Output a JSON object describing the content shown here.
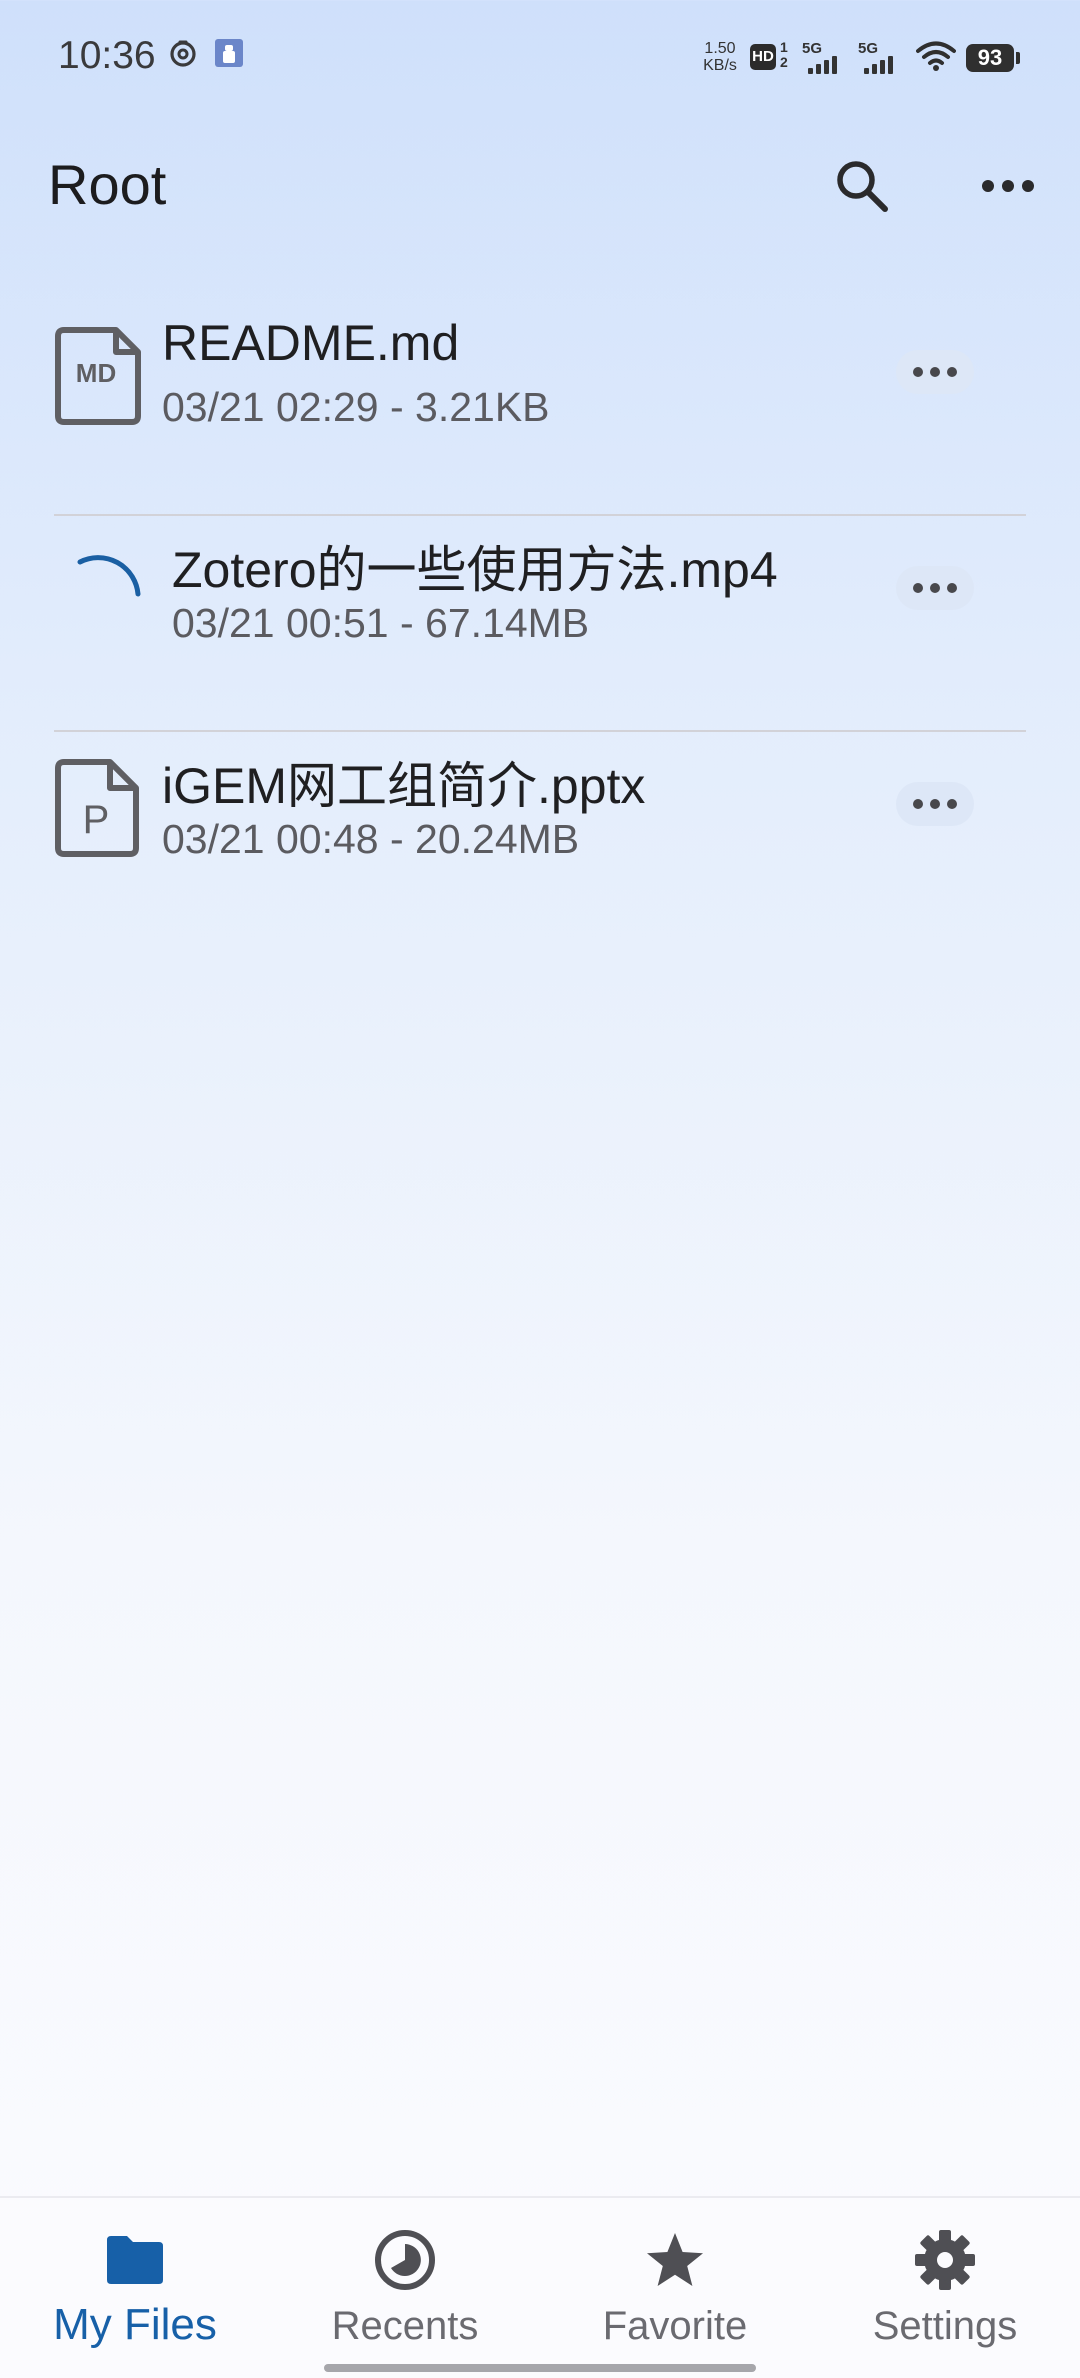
{
  "status_bar": {
    "time": "10:36",
    "network_speed_value": "1.50",
    "network_speed_unit": "KB/s",
    "hd_label": "HD",
    "hd_sub": "1 2",
    "signal_1": "5G",
    "signal_2": "5G",
    "battery": "93",
    "icons": [
      "netease-music-icon",
      "notification-app-icon",
      "wifi-icon"
    ]
  },
  "header": {
    "title": "Root",
    "icons": [
      "search-icon",
      "more-horizontal-icon"
    ]
  },
  "files": [
    {
      "name": "README.md",
      "meta": "03/21 02:29 - 3.21KB",
      "icon": "markdown-file-icon",
      "icon_text": "MD"
    },
    {
      "name": "Zotero的一些使用方法.mp4",
      "meta": "03/21 00:51 - 67.14MB",
      "icon": "loading-spinner-icon"
    },
    {
      "name": "iGEM网工组简介.pptx",
      "meta": "03/21 00:48 - 20.24MB",
      "icon": "powerpoint-file-icon",
      "icon_text": "P"
    }
  ],
  "nav": [
    {
      "label": "My Files",
      "icon": "folder-icon",
      "active": true
    },
    {
      "label": "Recents",
      "icon": "clock-icon",
      "active": false
    },
    {
      "label": "Favorite",
      "icon": "star-icon",
      "active": false
    },
    {
      "label": "Settings",
      "icon": "gear-icon",
      "active": false
    }
  ],
  "colors": {
    "accent": "#1760a8",
    "spinner": "#1a5fa3",
    "bg_top": "#cfe0fb",
    "bg_bottom": "#fbfbfe"
  }
}
